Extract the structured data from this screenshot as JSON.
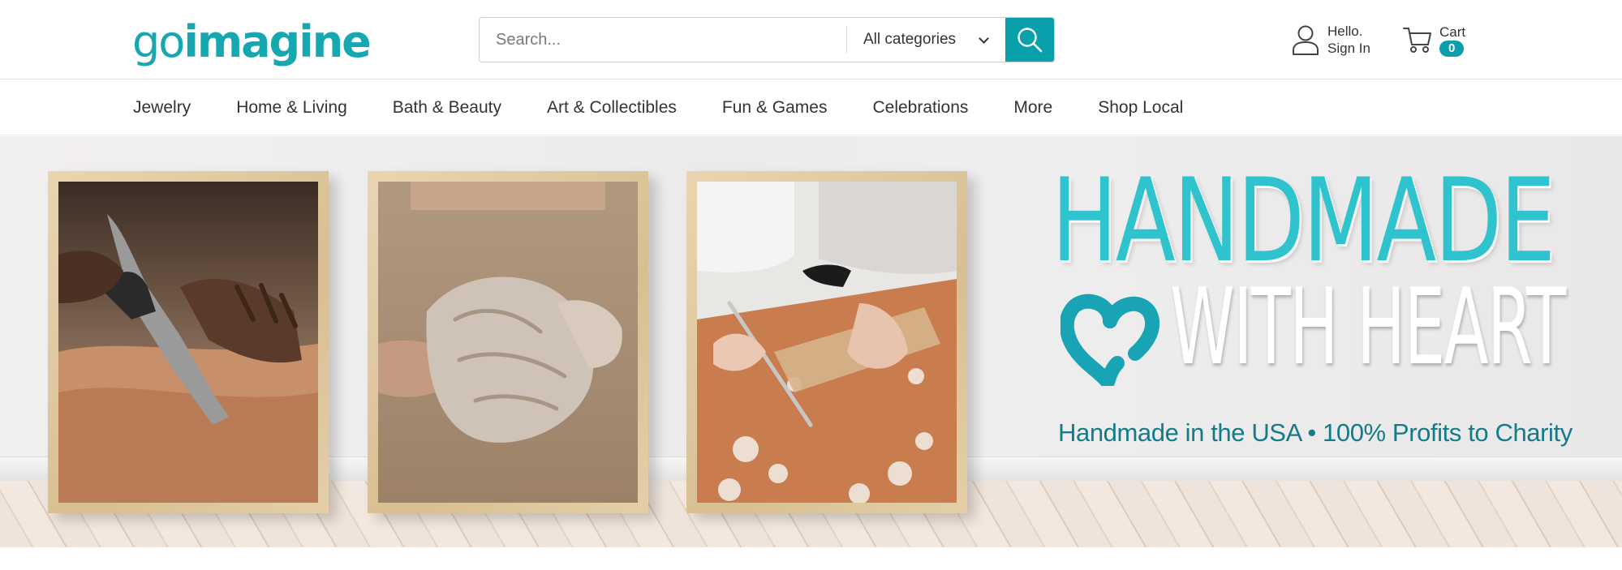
{
  "brand": {
    "logo_text_light": "go",
    "logo_text_bold": "imagine",
    "accent_color": "#0aa0ab",
    "logo_color": "#17a7b1"
  },
  "search": {
    "placeholder": "Search...",
    "category_value": "All categories",
    "button_icon": "search-icon"
  },
  "account": {
    "line1": "Hello.",
    "line2": "Sign In",
    "icon": "user-icon"
  },
  "cart": {
    "label": "Cart",
    "count": "0",
    "icon": "cart-icon"
  },
  "nav": {
    "items": [
      {
        "label": "Jewelry"
      },
      {
        "label": "Home & Living"
      },
      {
        "label": "Bath & Beauty"
      },
      {
        "label": "Art & Collectibles"
      },
      {
        "label": "Fun & Games"
      },
      {
        "label": "Celebrations"
      },
      {
        "label": "More"
      },
      {
        "label": "Shop Local"
      }
    ]
  },
  "hero": {
    "headline_top": "HANDMADE",
    "headline_bottom": "WITH HEART",
    "subline": "Handmade in the USA • 100% Profits to Charity",
    "headline_color": "#2ec3cd",
    "subline_color": "#127c89",
    "heart_icon": "heart-icon",
    "photos": [
      {
        "subject": "leather-cutting"
      },
      {
        "subject": "clay-hands"
      },
      {
        "subject": "drafting-ruler"
      }
    ]
  }
}
